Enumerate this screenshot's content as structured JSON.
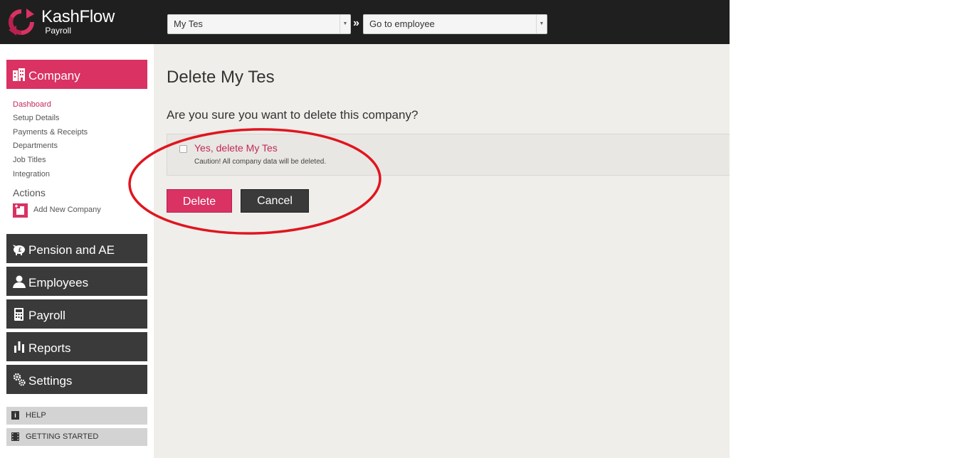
{
  "app": {
    "brand_name": "KashFlow",
    "brand_sub": "Payroll",
    "brand_color": "#d93263"
  },
  "topbar": {
    "company_select": {
      "value": "My Tes",
      "icon": "dropdown-arrow-icon"
    },
    "breadcrumb_separator": "»",
    "employee_select": {
      "value": "Go to employee",
      "icon": "dropdown-arrow-icon"
    }
  },
  "sidebar": {
    "company": {
      "label": "Company",
      "icon": "building-icon"
    },
    "sub_items": [
      {
        "label": "Dashboard",
        "active": true
      },
      {
        "label": "Setup Details"
      },
      {
        "label": "Payments & Receipts"
      },
      {
        "label": "Departments"
      },
      {
        "label": "Job Titles"
      },
      {
        "label": "Integration"
      }
    ],
    "actions_title": "Actions",
    "add_new_company": {
      "label": "Add New Company",
      "icon": "add-building-icon"
    },
    "sections": [
      {
        "label": "Pension and AE",
        "icon": "piggy-bank-icon"
      },
      {
        "label": "Employees",
        "icon": "person-icon"
      },
      {
        "label": "Payroll",
        "icon": "calculator-icon"
      },
      {
        "label": "Reports",
        "icon": "bar-chart-icon"
      },
      {
        "label": "Settings",
        "icon": "gears-icon"
      }
    ],
    "help": {
      "label": "HELP",
      "icon": "info-icon"
    },
    "getting_started": {
      "label": "GETTING STARTED",
      "icon": "film-icon"
    }
  },
  "main": {
    "title": "Delete My Tes",
    "question": "Are you sure you want to delete this company?",
    "confirm": {
      "label": "Yes, delete My Tes",
      "caution": "Caution! All company data will be deleted.",
      "checked": false
    },
    "delete_label": "Delete",
    "cancel_label": "Cancel"
  },
  "annotation": {
    "shape": "ellipse",
    "color": "#e0151f"
  }
}
